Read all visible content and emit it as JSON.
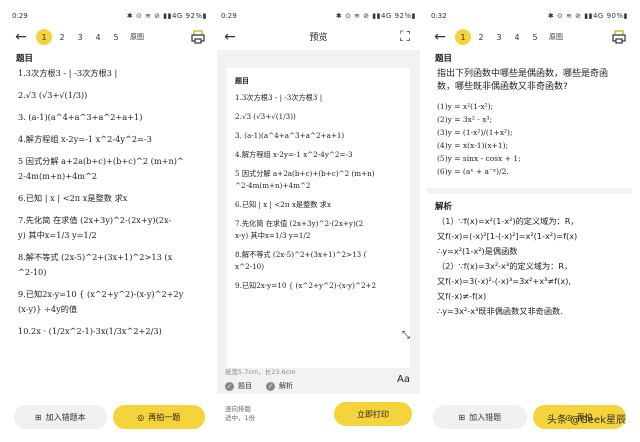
{
  "panel1": {
    "status": {
      "time": "0:29",
      "right": "✱ ⊙ ≋ ⊘ ▮▮4G 92%▮"
    },
    "pages": [
      "1",
      "2",
      "3",
      "4",
      "5"
    ],
    "orig_label": "原图",
    "section": "题目",
    "questions": [
      "1.3次方根3 - | -3次方根3 |",
      "2.√3 (√3+√(1/3))",
      "3. (a-1)(a^4+a^3+a^2+a+1)",
      "4.解方程组 x-2y=-1 x^2-4y^2=-3",
      "5 因式分解 a+2a(b+c)+(b+c)^2 (m+n)^",
      "2-4m(m+n)+4m^2",
      "6.已知 | x | <2π x是整数 求x",
      "7.先化简 在求值 (2x+3y)^2-(2x+y)(2x-",
      "y) 其中x=1/3 y=1/2",
      "8.解不等式 (2x-5)^2+(3x+1)^2>13 (x",
      "^2-10)",
      "9.已知2x-y=10 { (x^2+y^2)-(x-y)^2+2y",
      "(x-y)} ÷4y的值",
      "10.2x · (1/2x^2-1)-3x(1/3x^2+2/3)"
    ],
    "btn_left": "加入错题本",
    "btn_right": "再拍一题"
  },
  "panel2": {
    "status": {
      "time": "0:29",
      "right": "✱ ⊙ ≋ ⊘ ▮▮4G 92%▮"
    },
    "title": "预览",
    "section": "题目",
    "questions": [
      "1.3次方根3 - | -3次方根3 |",
      "2.√3 (√3+√(1/3))",
      "3. (a-1)(a^4+a^3+a^2+a+1)",
      "4.解方程组 x-2y=-1 x^2-4y^2=-3",
      "5 因式分解 a+2a(b+c)+(b+c)^2 (m+n)",
      "^2-4m(m+n)+4m^2",
      "6.已知 | x | <2π x是整数 求x",
      "7.先化简 在求值 (2x+3y)^2-(2x+y)(2",
      "x-y) 其中x=1/3 y=1/2",
      "8.解不等式 (2x-5)^2+(3x+1)^2>13 (",
      "x^2-10)",
      "9.已知2x-y=10 { (x^2+y^2)-(x-y)^2+2"
    ],
    "paper_meta": "纸宽5.7cm，长23.6cm",
    "opt1": "题目",
    "opt2": "解析",
    "setting1": "竖向排版",
    "setting2": "适中，1份",
    "print_btn": "立即打印",
    "aa": "Aa"
  },
  "panel3": {
    "status": {
      "time": "0:32",
      "right": "✱ ⊙ ≋ ⊘ ▮▮4G 90%▮"
    },
    "pages": [
      "1",
      "2",
      "3",
      "4",
      "5"
    ],
    "orig_label": "原图",
    "section": "题目",
    "headline": "指出下列函数中哪些是偶函数，哪些是奇函数，哪些既非偶函数又非奇函数?",
    "functions": [
      "(1)y = x²(1-x²);",
      "(2)y = 3x² - x³;",
      "(3)y = (1-x²)/(1+x²);",
      "(4)y = x(x-1)(x+1);",
      "(5)y = sinx - cosx + 1;",
      "(6)y = (aˣ + a⁻ˣ)/2."
    ],
    "analysis_label": "解析",
    "answers": [
      "（1）∵f(x)=x²(1-x²)的定义域为：R，",
      "又f(-x)=(-x)²[1-(-x)²]=x²(1-x²)=f(x)",
      "∴y=x²(1-x²)是偶函数",
      "（2）∵f(x)=3x²-x³的定义域为：R，",
      "又f(-x)=3(-x)²-(-x)³=3x²+x³≠f(x),",
      "又f(-x)≠-f(x)",
      "∴y=3x²-x³既非偶函数又非奇函数."
    ],
    "btn_left": "加入错题",
    "btn_right": "再拍",
    "watermark": "头条 @Geek星辰"
  }
}
